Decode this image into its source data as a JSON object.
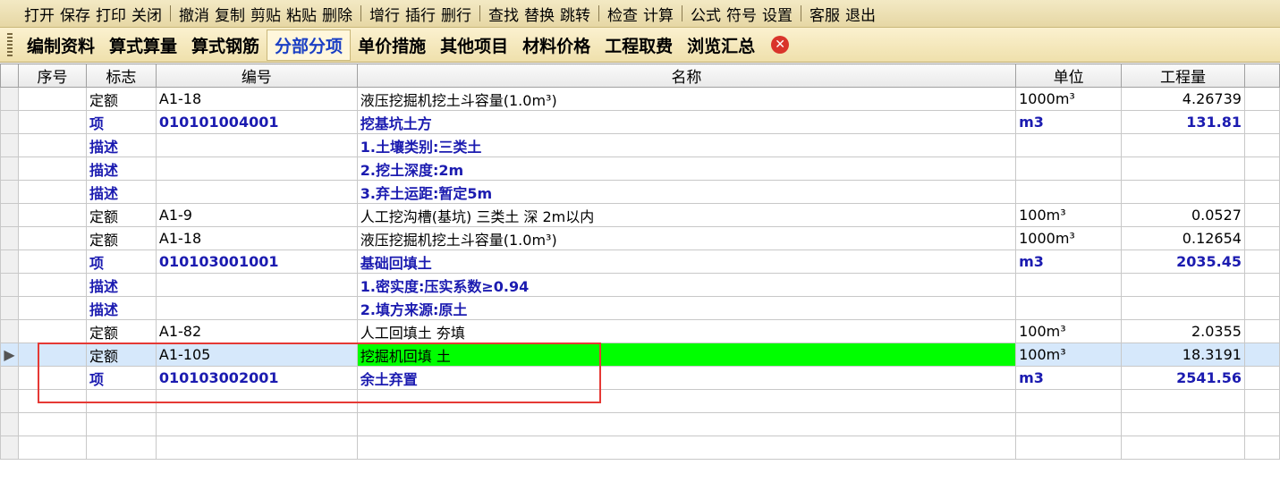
{
  "menu": {
    "groups": [
      [
        "打开",
        "保存",
        "打印",
        "关闭"
      ],
      [
        "撤消",
        "复制",
        "剪贴",
        "粘贴",
        "删除"
      ],
      [
        "增行",
        "插行",
        "删行"
      ],
      [
        "查找",
        "替换",
        "跳转"
      ],
      [
        "检查",
        "计算"
      ],
      [
        "公式",
        "符号",
        "设置"
      ],
      [
        "客服",
        "退出"
      ]
    ]
  },
  "tabs": [
    "编制资料",
    "算式算量",
    "算式钢筋",
    "分部分项",
    "单价措施",
    "其他项目",
    "材料价格",
    "工程取费",
    "浏览汇总"
  ],
  "active_tab_index": 3,
  "grid": {
    "headers": {
      "seq": "序号",
      "flag": "标志",
      "code": "编号",
      "name": "名称",
      "unit": "单位",
      "qty": "工程量"
    },
    "rows": [
      {
        "type": "定额",
        "flag": "定额",
        "code": "A1-18",
        "name": "液压挖掘机挖土斗容量(1.0m³)",
        "unit": "1000m³",
        "qty": "4.26739"
      },
      {
        "type": "项",
        "flag": "项",
        "code": "010101004001",
        "name": "挖基坑土方",
        "unit": "m3",
        "qty": "131.81"
      },
      {
        "type": "描述",
        "flag": "描述",
        "code": "",
        "name": "1.土壤类别:三类土",
        "unit": "",
        "qty": ""
      },
      {
        "type": "描述",
        "flag": "描述",
        "code": "",
        "name": "2.挖土深度:2m",
        "unit": "",
        "qty": ""
      },
      {
        "type": "描述",
        "flag": "描述",
        "code": "",
        "name": "3.弃土运距:暂定5m",
        "unit": "",
        "qty": ""
      },
      {
        "type": "定额",
        "flag": "定额",
        "code": "A1-9",
        "name": "人工挖沟槽(基坑) 三类土 深 2m以内",
        "unit": "100m³",
        "qty": "0.0527"
      },
      {
        "type": "定额",
        "flag": "定额",
        "code": "A1-18",
        "name": "液压挖掘机挖土斗容量(1.0m³)",
        "unit": "1000m³",
        "qty": "0.12654"
      },
      {
        "type": "项",
        "flag": "项",
        "code": "010103001001",
        "name": "基础回填土",
        "unit": "m3",
        "qty": "2035.45"
      },
      {
        "type": "描述",
        "flag": "描述",
        "code": "",
        "name": "1.密实度:压实系数≥0.94",
        "unit": "",
        "qty": ""
      },
      {
        "type": "描述",
        "flag": "描述",
        "code": "",
        "name": "2.填方来源:原土",
        "unit": "",
        "qty": ""
      },
      {
        "type": "定额",
        "flag": "定额",
        "code": "A1-82",
        "name": "人工回填土 夯填",
        "unit": "100m³",
        "qty": "2.0355"
      },
      {
        "type": "定额",
        "flag": "定额",
        "code": "A1-105",
        "name": "挖掘机回填 土",
        "unit": "100m³",
        "qty": "18.3191",
        "selected": true
      },
      {
        "type": "项",
        "flag": "项",
        "code": "010103002001",
        "name": "余土弃置",
        "unit": "m3",
        "qty": "2541.56"
      },
      {
        "type": "空",
        "flag": "",
        "code": "",
        "name": "",
        "unit": "",
        "qty": ""
      },
      {
        "type": "空",
        "flag": "",
        "code": "",
        "name": "",
        "unit": "",
        "qty": ""
      },
      {
        "type": "空",
        "flag": "",
        "code": "",
        "name": "",
        "unit": "",
        "qty": ""
      }
    ]
  },
  "colors": {
    "selected_name_bg": "#00ff00",
    "highlight_border": "#e53935",
    "item_text": "#1b1bb0"
  }
}
